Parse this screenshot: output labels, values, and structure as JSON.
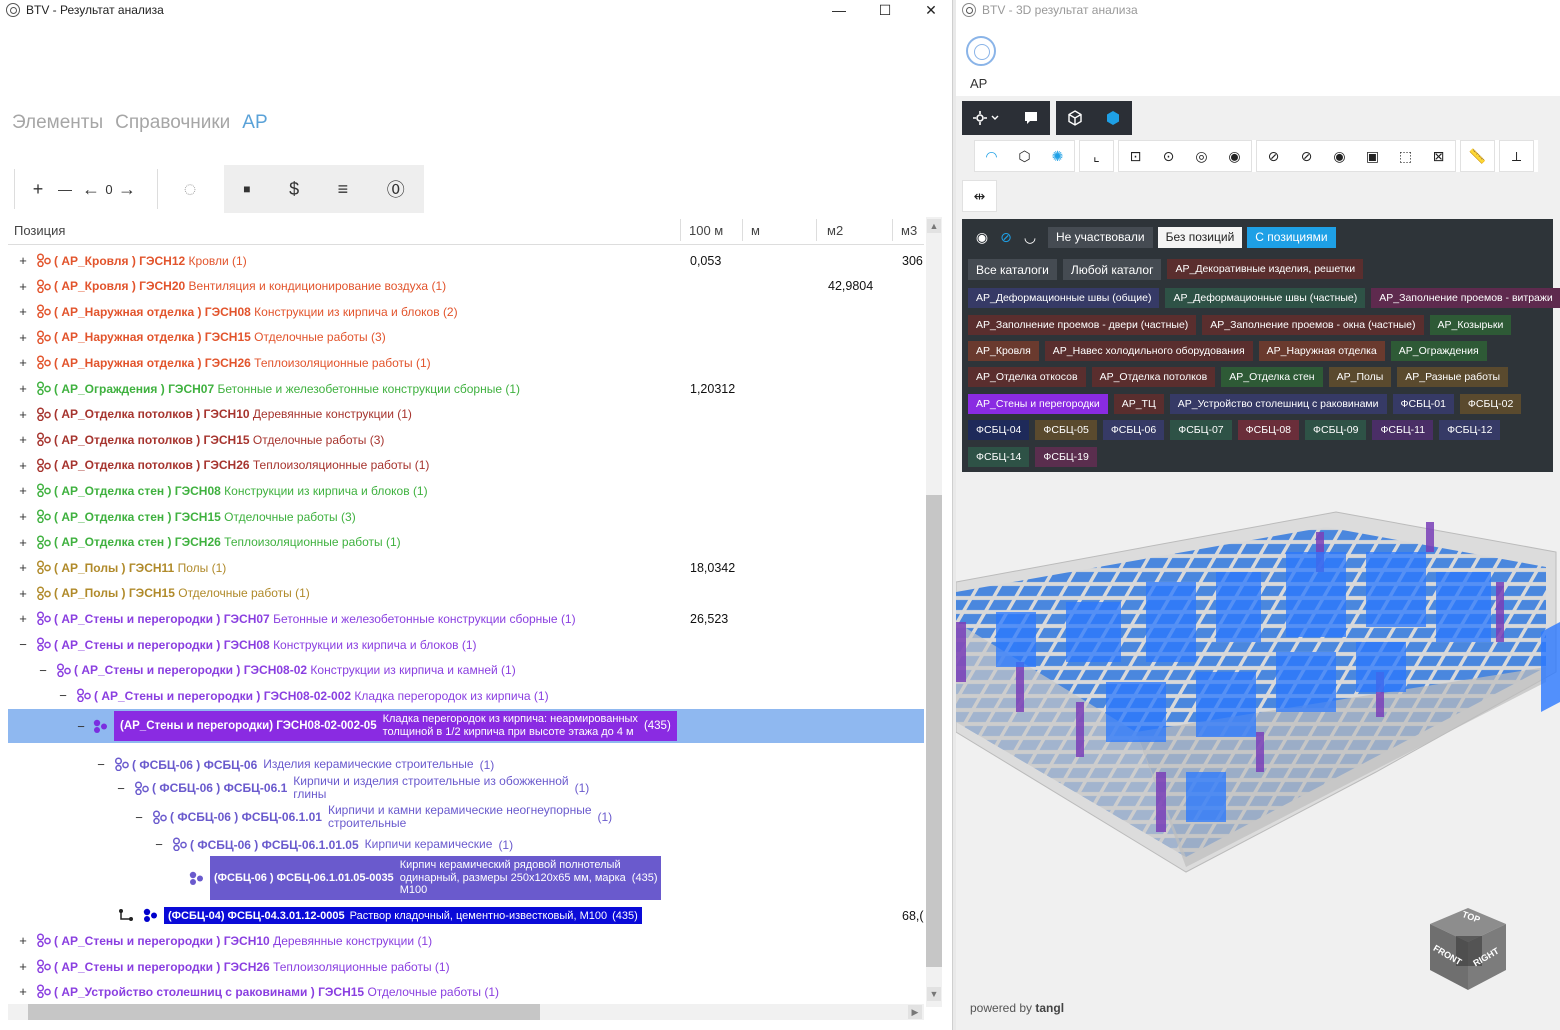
{
  "left_window": {
    "title": "BTV - Результат анализа",
    "controls": [
      "—",
      "☐",
      "✕"
    ],
    "tabs": [
      {
        "label": "Элементы",
        "active": false
      },
      {
        "label": "Справочники",
        "active": false
      },
      {
        "label": "АР",
        "active": true
      }
    ],
    "toolbar": {
      "plus": "+",
      "minus": "—",
      "back": "←",
      "counter": "0",
      "forward": "→",
      "spinner": "◌",
      "stop": "■",
      "dollar": "$",
      "list": "≡",
      "zero": "⓪"
    },
    "columns": [
      "Позиция",
      "100 м",
      "м",
      "м2",
      "м3"
    ],
    "rows": [
      {
        "pm": "+",
        "code": "( АР_Кровля ) ГЭСН12",
        "name": "Кровли",
        "count": "(1)",
        "color": "#e2542c",
        "v100": "0,053",
        "vm2": "",
        "vm3": "306"
      },
      {
        "pm": "+",
        "code": "( АР_Кровля ) ГЭСН20",
        "name": "Вентиляция и кондиционирование воздуха",
        "count": "(1)",
        "color": "#e2542c",
        "v100": "",
        "vm2": "42,9804",
        "vm3": ""
      },
      {
        "pm": "+",
        "code": "( АР_Наружная отделка ) ГЭСН08",
        "name": "Конструкции из кирпича и блоков",
        "count": "(2)",
        "color": "#e2542c",
        "v100": "",
        "vm2": "",
        "vm3": ""
      },
      {
        "pm": "+",
        "code": "( АР_Наружная отделка ) ГЭСН15",
        "name": "Отделочные работы",
        "count": "(3)",
        "color": "#e2542c",
        "v100": "",
        "vm2": "",
        "vm3": ""
      },
      {
        "pm": "+",
        "code": "( АР_Наружная отделка ) ГЭСН26",
        "name": "Теплоизоляционные работы",
        "count": "(1)",
        "color": "#e2542c",
        "v100": "",
        "vm2": "",
        "vm3": ""
      },
      {
        "pm": "+",
        "code": "( АР_Ограждения ) ГЭСН07",
        "name": "Бетонные и железобетонные конструкции сборные",
        "count": "(1)",
        "color": "#3fb13f",
        "v100": "1,20312",
        "vm2": "",
        "vm3": ""
      },
      {
        "pm": "+",
        "code": "( АР_Отделка потолков ) ГЭСН10",
        "name": "Деревянные конструкции",
        "count": "(1)",
        "color": "#a6342e",
        "v100": "",
        "vm2": "",
        "vm3": ""
      },
      {
        "pm": "+",
        "code": "( АР_Отделка потолков ) ГЭСН15",
        "name": "Отделочные работы",
        "count": "(3)",
        "color": "#a6342e",
        "v100": "",
        "vm2": "",
        "vm3": ""
      },
      {
        "pm": "+",
        "code": "( АР_Отделка потолков ) ГЭСН26",
        "name": "Теплоизоляционные работы",
        "count": "(1)",
        "color": "#a6342e",
        "v100": "",
        "vm2": "",
        "vm3": ""
      },
      {
        "pm": "+",
        "code": "( АР_Отделка стен ) ГЭСН08",
        "name": "Конструкции из кирпича и блоков",
        "count": "(1)",
        "color": "#3fb13f",
        "v100": "",
        "vm2": "",
        "vm3": ""
      },
      {
        "pm": "+",
        "code": "( АР_Отделка стен ) ГЭСН15",
        "name": "Отделочные работы",
        "count": "(3)",
        "color": "#3fb13f",
        "v100": "",
        "vm2": "",
        "vm3": ""
      },
      {
        "pm": "+",
        "code": "( АР_Отделка стен ) ГЭСН26",
        "name": "Теплоизоляционные работы",
        "count": "(1)",
        "color": "#3fb13f",
        "v100": "",
        "vm2": "",
        "vm3": ""
      },
      {
        "pm": "+",
        "code": "( АР_Полы ) ГЭСН11",
        "name": "Полы",
        "count": "(1)",
        "color": "#b08a2a",
        "v100": "18,0342",
        "vm2": "",
        "vm3": ""
      },
      {
        "pm": "+",
        "code": "( АР_Полы ) ГЭСН15",
        "name": "Отделочные работы",
        "count": "(1)",
        "color": "#b08a2a",
        "v100": "",
        "vm2": "",
        "vm3": ""
      },
      {
        "pm": "+",
        "code": "( АР_Стены и перегородки ) ГЭСН07",
        "name": "Бетонные и железобетонные конструкции сборные",
        "count": "(1)",
        "color": "#8a3fe0",
        "v100": "26,523",
        "vm2": "",
        "vm3": ""
      },
      {
        "pm": "−",
        "code": "( АР_Стены и перегородки ) ГЭСН08",
        "name": "Конструкции из кирпича и блоков",
        "count": "(1)",
        "color": "#8a3fe0",
        "v100": "",
        "vm2": "",
        "vm3": ""
      },
      {
        "pm": "−",
        "code": "( АР_Стены и перегородки ) ГЭСН08-02",
        "name": "Конструкции из кирпича и камней",
        "count": "(1)",
        "color": "#8a3fe0",
        "v100": "",
        "vm2": "",
        "vm3": ""
      },
      {
        "pm": "−",
        "code": "( АР_Стены и перегородки ) ГЭСН08-02-002",
        "name": "Кладка перегородок из кирпича",
        "count": "(1)",
        "color": "#8a3fe0",
        "v100": "",
        "vm2": "",
        "vm3": ""
      }
    ],
    "selected_row": {
      "pm": "−",
      "code": "(АР_Стены и перегородки) ГЭСН08-02-002-05",
      "name_line1": "Кладка перегородок из кирпича: неармированных",
      "name_line2": "толщиной в 1/2 кирпича при высоте этажа до 4 м",
      "count": "(435)"
    },
    "sub_rows": [
      {
        "pm": "−",
        "code": "( ФСБЦ-06 ) ФСБЦ-06",
        "name": "Изделия керамические строительные",
        "name2": "",
        "count": "(1)"
      },
      {
        "pm": "−",
        "code": "( ФСБЦ-06 ) ФСБЦ-06.1",
        "name": "Кирпичи и изделия строительные из обожженной",
        "name2": "глины",
        "count": "(1)"
      },
      {
        "pm": "−",
        "code": "( ФСБЦ-06 ) ФСБЦ-06.1.01",
        "name": "Кирпичи и камни керамические неогнеупорные",
        "name2": "строительные",
        "count": "(1)"
      },
      {
        "pm": "−",
        "code": "( ФСБЦ-06 ) ФСБЦ-06.1.01.05",
        "name": "Кирпичи керамические",
        "name2": "",
        "count": "(1)"
      }
    ],
    "brick_item": {
      "code": "(ФСБЦ-06 ) ФСБЦ-06.1.01.05-0035",
      "line1": "Кирпич керамический рядовой полнотелый",
      "line2": "одинарный, размеры 250х120х65 мм, марка",
      "line3": "М100",
      "count": "(435)"
    },
    "mortar_item": {
      "code": "(ФСБЦ-04) ФСБЦ-04.3.01.12-0005",
      "name": "Раствор кладочный, цементно-известковый, М100",
      "count": "(435)",
      "vm3": "68,("
    },
    "bottom_rows": [
      {
        "pm": "+",
        "code": "( АР_Стены и перегородки ) ГЭСН10",
        "name": "Деревянные конструкции",
        "count": "(1)",
        "color": "#8a3fe0"
      },
      {
        "pm": "+",
        "code": "( АР_Стены и перегородки ) ГЭСН26",
        "name": "Теплоизоляционные работы",
        "count": "(1)",
        "color": "#8a3fe0"
      },
      {
        "pm": "+",
        "code": "( АР_Устройство столешниц с раковинами ) ГЭСН15",
        "name": "Отделочные работы",
        "count": "(1)",
        "color": "#8a3fe0"
      }
    ]
  },
  "right_window": {
    "title": "BTV - 3D результат анализа",
    "model_label": "АР",
    "filter": {
      "chips": [
        {
          "label": "Не участвовали",
          "bg": "#454b52",
          "fg": "#ffffff"
        },
        {
          "label": "Без позиций",
          "bg": "#f4f4f4",
          "fg": "#222222"
        },
        {
          "label": "С позициями",
          "bg": "#1ea0e6",
          "fg": "#ffffff"
        }
      ],
      "catalog_chips": [
        {
          "label": "Все каталоги"
        },
        {
          "label": "Любой каталог"
        }
      ],
      "tags": [
        {
          "label": "АР_Декоративные изделия, решетки",
          "bg": "#5a2e2e"
        },
        {
          "label": "АР_Деформационные швы (общие)",
          "bg": "#363a66"
        },
        {
          "label": "АР_Деформационные швы (частные)",
          "bg": "#2e5246"
        },
        {
          "label": "АР_Заполнение проемов - витражи",
          "bg": "#5e2a4e"
        },
        {
          "label": "АР_Заполнение проемов - двери (частные)",
          "bg": "#5a2e2e"
        },
        {
          "label": "АР_Заполнение проемов - окна (частные)",
          "bg": "#5a2e2e"
        },
        {
          "label": "АР_Козырьки",
          "bg": "#2e5a36"
        },
        {
          "label": "АР_Кровля",
          "bg": "#6a3a2e"
        },
        {
          "label": "АР_Навес холодильного оборудования",
          "bg": "#5a2e2e"
        },
        {
          "label": "АР_Наружная отделка",
          "bg": "#6a3a2e"
        },
        {
          "label": "АР_Ограждения",
          "bg": "#2e5a36"
        },
        {
          "label": "АР_Отделка откосов",
          "bg": "#5a2e2e"
        },
        {
          "label": "АР_Отделка потолков",
          "bg": "#5a2e2e"
        },
        {
          "label": "АР_Отделка стен",
          "bg": "#2e5a36"
        },
        {
          "label": "АР_Полы",
          "bg": "#5a4a2e"
        },
        {
          "label": "АР_Разные работы",
          "bg": "#5a4a2e"
        },
        {
          "label": "АР_Стены и перегородки",
          "bg": "#8a2be2"
        },
        {
          "label": "АР_ТЦ",
          "bg": "#5a2e2e"
        },
        {
          "label": "АР_Устройство столешниц с раковинами",
          "bg": "#363a66"
        },
        {
          "label": "ФСБЦ-01",
          "bg": "#363a66"
        },
        {
          "label": "ФСБЦ-02",
          "bg": "#5a4a2e"
        },
        {
          "label": "ФСБЦ-04",
          "bg": "#1e2a5a"
        },
        {
          "label": "ФСБЦ-05",
          "bg": "#5a4a2e"
        },
        {
          "label": "ФСБЦ-06",
          "bg": "#363a66"
        },
        {
          "label": "ФСБЦ-07",
          "bg": "#2e5246"
        },
        {
          "label": "ФСБЦ-08",
          "bg": "#6a2e3a"
        },
        {
          "label": "ФСБЦ-09",
          "bg": "#2e5246"
        },
        {
          "label": "ФСБЦ-11",
          "bg": "#4a2e66"
        },
        {
          "label": "ФСБЦ-12",
          "bg": "#363a66"
        },
        {
          "label": "ФСБЦ-14",
          "bg": "#2e5246"
        },
        {
          "label": "ФСБЦ-19",
          "bg": "#5a2e4e"
        }
      ]
    },
    "viewcube": {
      "top": "TOP",
      "front": "FRONT",
      "right": "RIGHT"
    },
    "powered_text": "powered by",
    "powered_brand": "tangl"
  }
}
